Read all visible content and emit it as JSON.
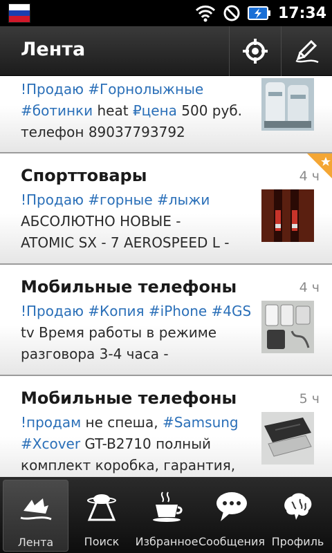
{
  "status_bar": {
    "time": "17:34",
    "icons": [
      "russia-flag-icon",
      "wifi-icon",
      "no-signal-icon",
      "battery-charging-icon"
    ]
  },
  "action_bar": {
    "title": "Лента",
    "buttons": [
      "locate-icon",
      "compose-icon"
    ]
  },
  "feed": {
    "items": [
      {
        "category": "",
        "age": "",
        "lines": [
          [
            {
              "t": "!Продаю ",
              "tag": true
            },
            {
              "t": "#Горнолыжные",
              "tag": true
            }
          ],
          [
            {
              "t": "#ботинки",
              "tag": true
            },
            {
              "t": " heat ",
              "tag": false
            },
            {
              "t": "₽цена",
              "tag": true
            },
            {
              "t": " 500 руб.",
              "tag": false
            }
          ],
          [
            {
              "t": "телефон 89037793792",
              "tag": false
            }
          ]
        ],
        "thumb": "ski-boots-photo",
        "starred": false
      },
      {
        "category": "Спорттовары",
        "age": "4 ч",
        "lines": [
          [
            {
              "t": "!Продаю ",
              "tag": true
            },
            {
              "t": "#горные ",
              "tag": true
            },
            {
              "t": "#лыжи",
              "tag": true
            }
          ],
          [
            {
              "t": "АБСОЛЮТНО НОВЫЕ -",
              "tag": false
            }
          ],
          [
            {
              "t": "ATOMIC SX - 7 AEROSPEED L -",
              "tag": false
            }
          ]
        ],
        "thumb": "skis-photo",
        "starred": true
      },
      {
        "category": "Мобильные телефоны",
        "age": "4 ч",
        "lines": [
          [
            {
              "t": "!Продаю ",
              "tag": true
            },
            {
              "t": "#Копия ",
              "tag": true
            },
            {
              "t": "#iPhone ",
              "tag": true
            },
            {
              "t": "#4GS",
              "tag": true
            }
          ],
          [
            {
              "t": "tv Время работы в режиме",
              "tag": false
            }
          ],
          [
            {
              "t": "разговора 3-4 часа -",
              "tag": false
            }
          ]
        ],
        "thumb": "iphone-photo",
        "starred": false
      },
      {
        "category": "Мобильные телефоны",
        "age": "5 ч",
        "lines": [
          [
            {
              "t": "!продам",
              "tag": true
            },
            {
              "t": " не спеша, ",
              "tag": false
            },
            {
              "t": "#Samsung",
              "tag": true
            }
          ],
          [
            {
              "t": "#Xcover",
              "tag": true
            },
            {
              "t": " GT-B2710 полный",
              "tag": false
            }
          ],
          [
            {
              "t": "комплект коробка, гарантия,",
              "tag": false
            }
          ]
        ],
        "thumb": "samsung-phone-photo",
        "starred": false
      }
    ]
  },
  "tab_bar": {
    "tabs": [
      {
        "label": "Лента",
        "icon": "feed-boat-icon",
        "active": true
      },
      {
        "label": "Поиск",
        "icon": "ufo-icon",
        "active": false
      },
      {
        "label": "Избранное",
        "icon": "coffee-cup-icon",
        "active": false
      },
      {
        "label": "Сообщения",
        "icon": "speech-bubble-icon",
        "active": false
      },
      {
        "label": "Профиль",
        "icon": "brain-icon",
        "active": false
      }
    ]
  },
  "colors": {
    "tag": "#2a6fb8",
    "text": "#2a2a2a",
    "star": "#f4a634"
  }
}
